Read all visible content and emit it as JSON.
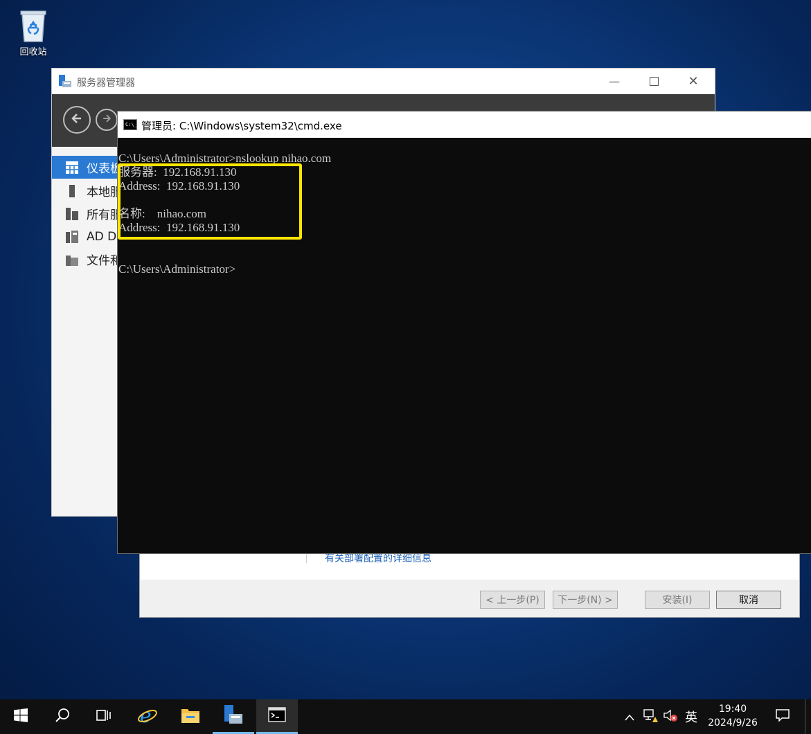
{
  "desktop": {
    "recycle_bin_label": "回收站"
  },
  "server_manager": {
    "title": "服务器管理器",
    "sidebar": [
      {
        "label": "仪表板",
        "icon": "dashboard-icon",
        "active": true
      },
      {
        "label": "本地服务器",
        "icon": "local-server-icon",
        "active": false
      },
      {
        "label": "所有服务器",
        "icon": "all-servers-icon",
        "active": false
      },
      {
        "label": "AD DS",
        "icon": "ad-ds-icon",
        "active": false
      },
      {
        "label": "文件和存储服务",
        "icon": "file-storage-icon",
        "active": false
      }
    ]
  },
  "wizard": {
    "link_text": "有关部署配置的详细信息",
    "buttons": {
      "prev": "< 上一步(P)",
      "next": "下一步(N) >",
      "install": "安装(I)",
      "cancel": "取消"
    }
  },
  "cmd": {
    "title": "管理员: C:\\Windows\\system32\\cmd.exe",
    "lines": [
      "C:\\Users\\Administrator>nslookup nihao.com",
      "服务器:  192.168.91.130",
      "Address:  192.168.91.130",
      "",
      "名称:    nihao.com",
      "Address:  192.168.91.130",
      "",
      "C:\\Users\\Administrator>"
    ]
  },
  "taskbar": {
    "items": [
      "start-icon",
      "search-icon",
      "task-view-icon",
      "ie-icon",
      "file-explorer-icon",
      "server-manager-icon",
      "cmd-icon"
    ],
    "tray": {
      "chevron": "^",
      "ime": "英",
      "time": "19:40",
      "date": "2024/9/26"
    }
  },
  "colors": {
    "highlight": "#ffe600",
    "accent": "#2a7ad4"
  }
}
